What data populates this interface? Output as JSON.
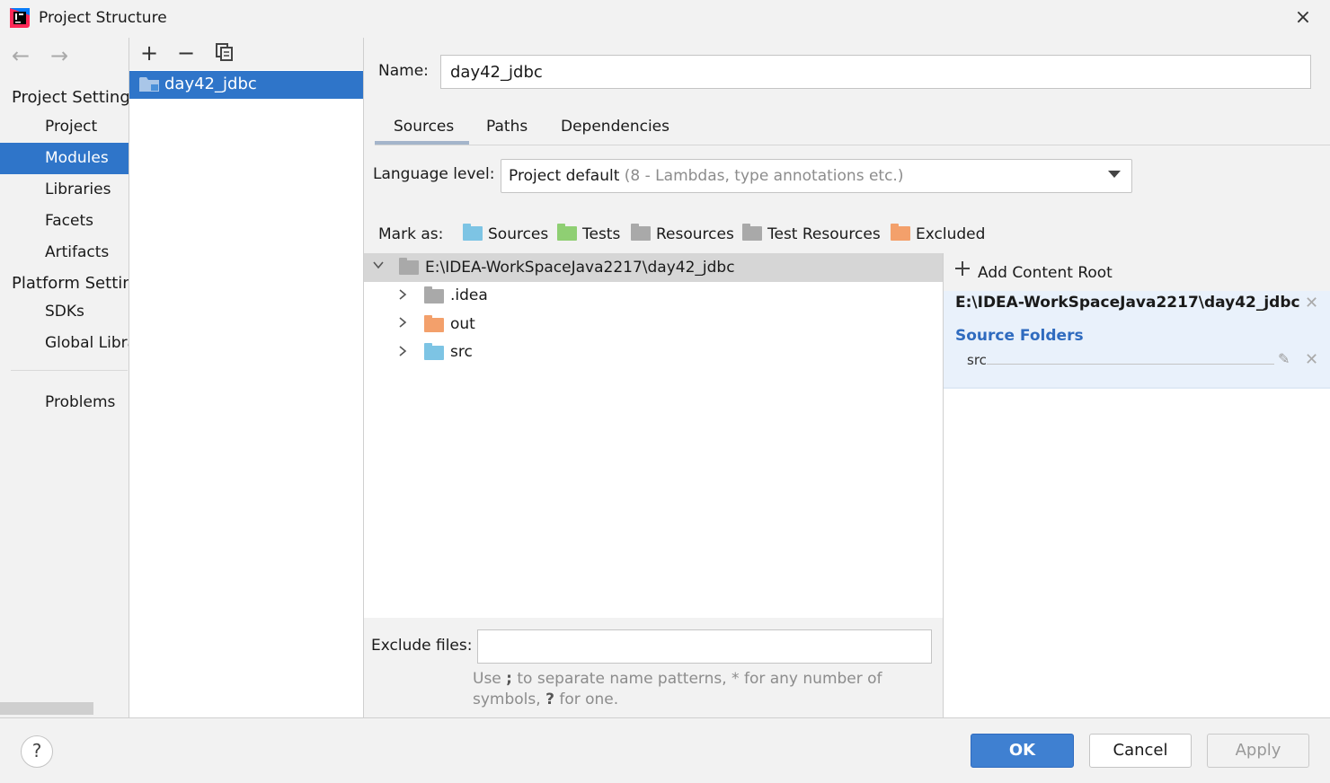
{
  "window": {
    "title": "Project Structure",
    "close_icon": "×"
  },
  "nav": {
    "back_icon": "←",
    "forward_icon": "→"
  },
  "sidebar": {
    "project_settings_header": "Project Settings",
    "platform_settings_header": "Platform Settings",
    "items": [
      {
        "label": "Project",
        "selected": false
      },
      {
        "label": "Modules",
        "selected": true
      },
      {
        "label": "Libraries",
        "selected": false
      },
      {
        "label": "Facets",
        "selected": false
      },
      {
        "label": "Artifacts",
        "selected": false
      }
    ],
    "platform_items": [
      {
        "label": "SDKs"
      },
      {
        "label": "Global Libraries"
      }
    ],
    "problems_label": "Problems"
  },
  "module_list": {
    "add_icon": "+",
    "remove_icon": "−",
    "items": [
      {
        "label": "day42_jdbc",
        "selected": true
      }
    ]
  },
  "module": {
    "name_label": "Name:",
    "name_value": "day42_jdbc",
    "tabs": [
      {
        "label": "Sources",
        "active": true
      },
      {
        "label": "Paths",
        "active": false
      },
      {
        "label": "Dependencies",
        "active": false
      }
    ],
    "language_level_label": "Language level:",
    "language_level_value": "Project default",
    "language_level_hint": "(8 - Lambdas, type annotations etc.)",
    "mark_as_label": "Mark as:",
    "mark_as": [
      {
        "label": "Sources",
        "color": "#7dc4e4"
      },
      {
        "label": "Tests",
        "color": "#8fcf73"
      },
      {
        "label": "Resources",
        "color": "#a9a9a9"
      },
      {
        "label": "Test Resources",
        "color": "#a9a9a9"
      },
      {
        "label": "Excluded",
        "color": "#f3a06b"
      }
    ],
    "tree": {
      "root": "E:\\IDEA-WorkSpaceJava2217\\day42_jdbc",
      "children": [
        {
          "label": ".idea",
          "color": "#a9a9a9"
        },
        {
          "label": "out",
          "color": "#f3a06b"
        },
        {
          "label": "src",
          "color": "#7dc4e4"
        }
      ]
    },
    "content_root": {
      "add_label": "Add Content Root",
      "path": "E:\\IDEA-WorkSpaceJava2217\\day42_jdbc",
      "source_folders_title": "Source Folders",
      "source_folders": [
        "src"
      ]
    },
    "exclude_files_label": "Exclude files:",
    "exclude_files_value": "",
    "exclude_hint_1": "Use ",
    "exclude_hint_sep": ";",
    "exclude_hint_2": " to separate name patterns, * for any number of symbols, ",
    "exclude_hint_q": "?",
    "exclude_hint_3": " for one."
  },
  "buttons": {
    "help": "?",
    "ok": "OK",
    "cancel": "Cancel",
    "apply": "Apply"
  },
  "colors": {
    "selection": "#2f75c9",
    "ok_button": "#3f80d1",
    "source_folder_title": "#2f6bbf"
  }
}
